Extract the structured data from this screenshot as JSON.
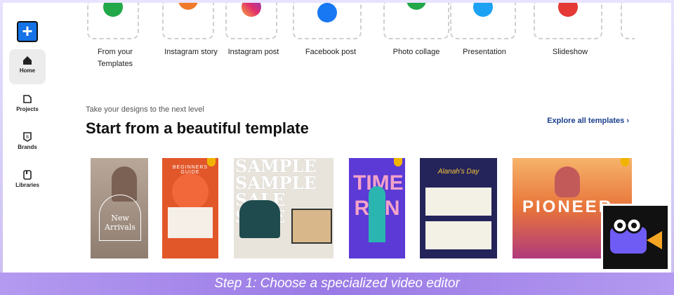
{
  "sidebar": {
    "new_label": "+",
    "items": [
      {
        "label": "Home",
        "icon": "home-icon"
      },
      {
        "label": "Projects",
        "icon": "projects-icon"
      },
      {
        "label": "Brands",
        "icon": "brands-icon"
      },
      {
        "label": "Libraries",
        "icon": "libraries-icon"
      }
    ]
  },
  "quick_actions": [
    {
      "label": "From your\nTemplates",
      "color": "#22a849"
    },
    {
      "label": "Instagram story",
      "color": "#f07a2a"
    },
    {
      "label": "Instagram post",
      "color": "#e1306c"
    },
    {
      "label": "Facebook post",
      "color": "#1877f2"
    },
    {
      "label": "Photo collage",
      "color": "#22a849"
    },
    {
      "label": "Presentation",
      "color": "#1da1f2"
    },
    {
      "label": "Slideshow",
      "color": "#e53935"
    }
  ],
  "section": {
    "subtitle": "Take your designs to the next level",
    "title": "Start from a beautiful template",
    "explore": "Explore all templates"
  },
  "templates": [
    {
      "text": "New Arrivals",
      "bg": "#b9a89a"
    },
    {
      "text": "BEGINNERS GUIDE",
      "bg": "#e2572a"
    },
    {
      "text": "SAMPLE SAMPLE SALE SALE",
      "bg": "#e8e4dc"
    },
    {
      "text": "TIME RUN",
      "bg": "#5b3ad6"
    },
    {
      "text": "Alanah's Day",
      "bg": "#24245a"
    },
    {
      "text": "PIONEER",
      "bg": "#e8743a"
    }
  ],
  "caption": "Step 1: Choose a specialized video editor"
}
